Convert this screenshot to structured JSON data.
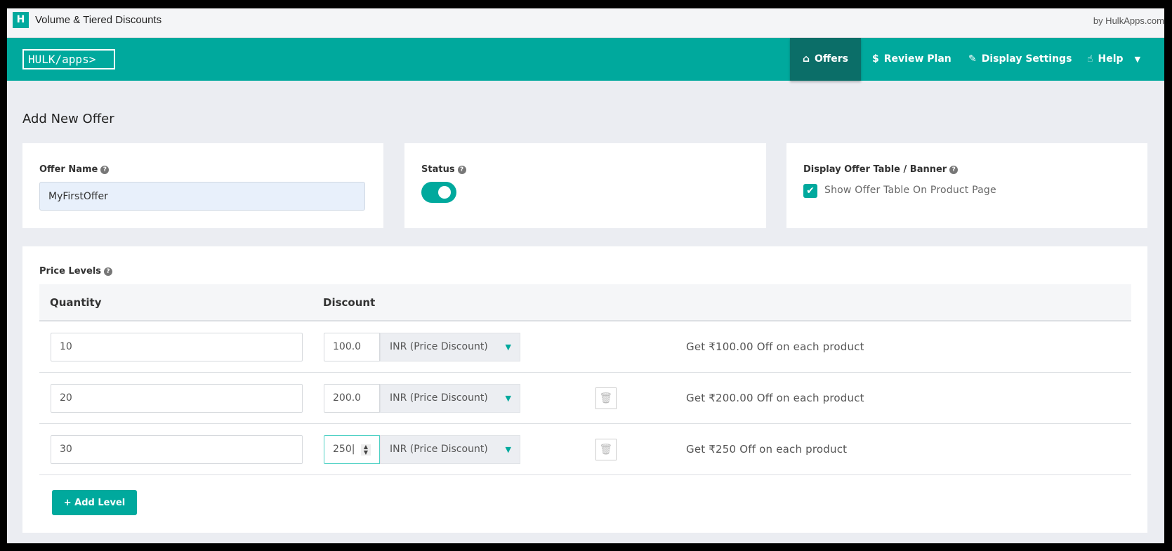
{
  "window": {
    "title": "Volume & Tiered Discounts",
    "byline": "by HulkApps.com",
    "app_icon": "H"
  },
  "nav": {
    "logo": "HULK/apps>",
    "items": [
      {
        "label": "Offers",
        "icon": "home-icon",
        "glyph": "⌂",
        "active": true
      },
      {
        "label": "Review Plan",
        "icon": "dollar-icon",
        "glyph": "$"
      },
      {
        "label": "Display Settings",
        "icon": "wrench-icon",
        "glyph": "✎"
      },
      {
        "label": "Help",
        "icon": "thumbs-up-icon",
        "glyph": "☝"
      }
    ],
    "dropdown_glyph": "▼"
  },
  "page": {
    "title": "Add New Offer"
  },
  "offer_name": {
    "label": "Offer Name",
    "value": "MyFirstOffer"
  },
  "status": {
    "label": "Status",
    "enabled": true
  },
  "display": {
    "label": "Display Offer Table / Banner",
    "checkbox_label": "Show Offer Table On Product Page",
    "checked": true
  },
  "price_levels": {
    "label": "Price Levels",
    "headers": {
      "quantity": "Quantity",
      "discount": "Discount"
    },
    "rows": [
      {
        "quantity": "10",
        "discount": "100.0",
        "type": "INR (Price Discount)",
        "message": "Get ₹100.00 Off on each product",
        "deletable": false
      },
      {
        "quantity": "20",
        "discount": "200.0",
        "type": "INR (Price Discount)",
        "message": "Get ₹200.00 Off on each product",
        "deletable": true
      },
      {
        "quantity": "30",
        "discount": "250",
        "type": "INR (Price Discount)",
        "message": "Get ₹250 Off on each product",
        "deletable": true,
        "focused": true
      }
    ],
    "add_label": "+ Add Level"
  },
  "colors": {
    "accent": "#00a99d",
    "nav_active": "#0b6e68",
    "background": "#ebedf2"
  }
}
